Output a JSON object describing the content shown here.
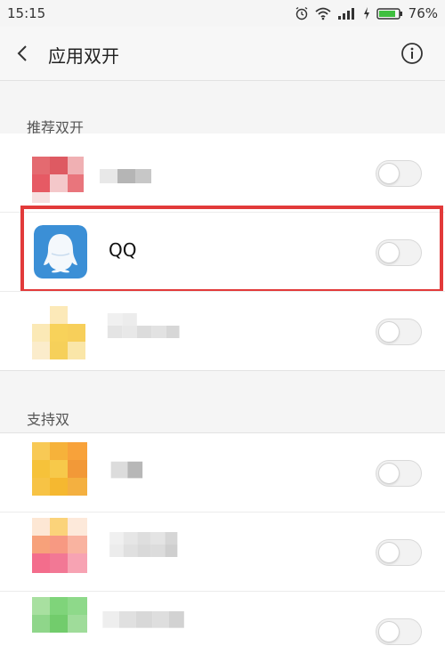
{
  "status_bar": {
    "time": "15:15",
    "battery": "76%",
    "icons": [
      "alarm-icon",
      "wifi-icon",
      "signal-icon",
      "charging-icon",
      "battery-icon"
    ]
  },
  "header": {
    "title": "应用双开",
    "back_icon": "chevron-left-icon",
    "info_icon": "info-icon"
  },
  "sections": {
    "recommended": {
      "label": "推荐双开",
      "items": [
        {
          "name": "",
          "blurred": true,
          "enabled": false
        },
        {
          "name": "QQ",
          "blurred": false,
          "enabled": false,
          "highlighted": true
        },
        {
          "name": "",
          "blurred": true,
          "enabled": false
        }
      ]
    },
    "supported": {
      "label": "支持双",
      "items": [
        {
          "name": "",
          "blurred": true,
          "enabled": false
        },
        {
          "name": "",
          "blurred": true,
          "enabled": false
        },
        {
          "name": "",
          "blurred": true,
          "enabled": false
        }
      ]
    }
  },
  "colors": {
    "highlight": "#e23a3a",
    "qq_blue": "#3b8fd6",
    "background": "#f5f5f5"
  }
}
